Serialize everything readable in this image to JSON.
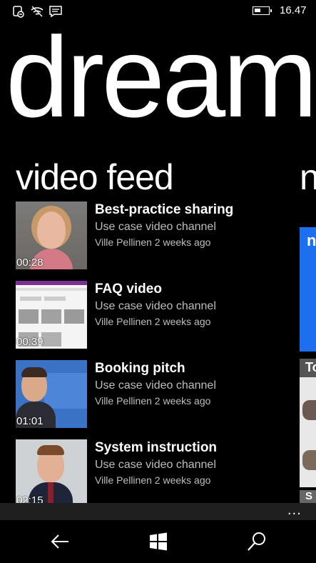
{
  "status_bar": {
    "time": "16.47",
    "battery_level": 0.45,
    "icons": [
      "dnd-icon",
      "wifi-icon",
      "message-icon",
      "battery-icon"
    ]
  },
  "app": {
    "title": "dream"
  },
  "feed": {
    "title": "video feed",
    "next_section_peek": "n",
    "items": [
      {
        "title": "Best-practice sharing",
        "channel": "Use case video channel",
        "meta": "Ville Pellinen 2 weeks ago",
        "duration": "00:28"
      },
      {
        "title": "FAQ video",
        "channel": "Use case video channel",
        "meta": "Ville Pellinen 2 weeks ago",
        "duration": "00:39"
      },
      {
        "title": "Booking pitch",
        "channel": "Use case video channel",
        "meta": "Ville Pellinen 2 weeks ago",
        "duration": "01:01"
      },
      {
        "title": "System instruction",
        "channel": "Use case video channel",
        "meta": "Ville Pellinen 2 weeks ago",
        "duration": "02:15"
      }
    ]
  },
  "peek_column": {
    "tile1_text": "n",
    "tile2_text": "To",
    "tile3_text": "S"
  },
  "app_bar": {
    "more_label": "..."
  },
  "nav_bar": {
    "icons": [
      "back-arrow-icon",
      "windows-start-icon",
      "search-icon"
    ]
  },
  "colors": {
    "accent": "#1e6ff0",
    "background": "#000000",
    "app_bar": "#1f1f1f",
    "secondary_text": "#bdbdbd"
  }
}
